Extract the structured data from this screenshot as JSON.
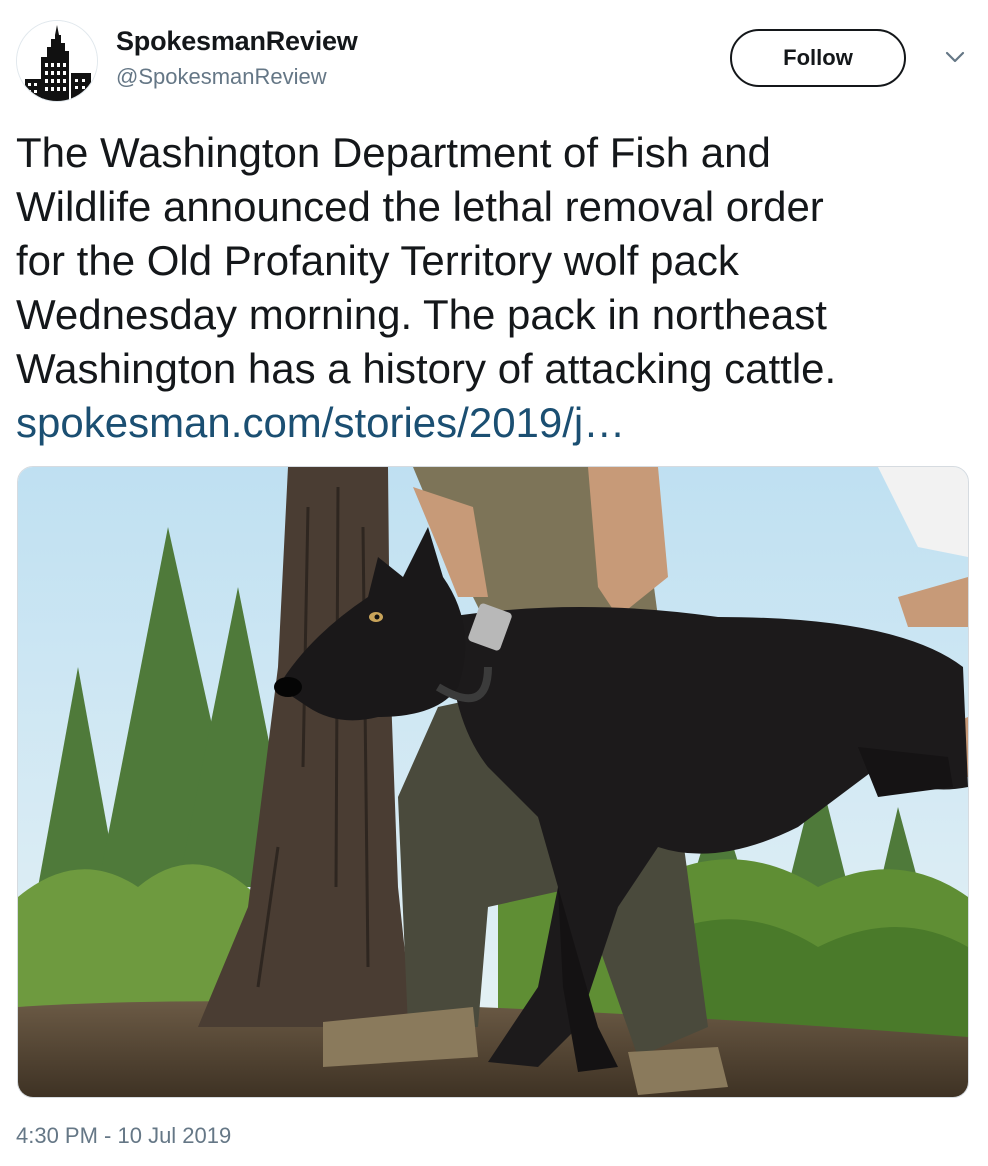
{
  "account": {
    "display_name": "SpokesmanReview",
    "handle": "@SpokesmanReview",
    "avatar_icon": "building-tower-logo"
  },
  "actions": {
    "follow_label": "Follow",
    "more_icon": "chevron-down-icon"
  },
  "tweet": {
    "lines": [
      "The Washington Department of Fish and",
      "Wildlife announced the lethal removal order",
      "for the Old Profanity Territory wolf pack",
      "Wednesday morning. The pack in northeast",
      "Washington has a history of attacking cattle."
    ],
    "link": "spokesman.com/stories/2019/j…",
    "timestamp": "4:30 PM - 10 Jul 2019"
  },
  "media": {
    "type": "photo",
    "subject": "black wolf held by wildlife workers in forest"
  },
  "colors": {
    "text": "#14171a",
    "secondary": "#657786",
    "link": "#1b4f72",
    "border": "#d6dbe0"
  }
}
